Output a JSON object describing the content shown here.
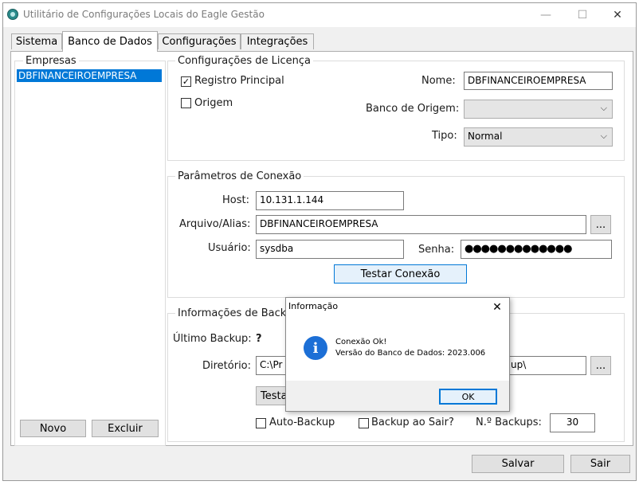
{
  "window": {
    "title": "Utilitário de Configurações Locais do Eagle Gestão",
    "minimize": "—",
    "maximize": "☐",
    "close": "✕"
  },
  "tabs": [
    {
      "label": "Sistema"
    },
    {
      "label": "Banco de Dados"
    },
    {
      "label": "Configurações"
    },
    {
      "label": "Integrações"
    }
  ],
  "empresas": {
    "label": "Empresas",
    "items": [
      "DBFINANCEIROEMPRESA"
    ],
    "novo": "Novo",
    "excluir": "Excluir"
  },
  "licenca": {
    "label": "Configurações de Licença",
    "registro_principal": "Registro Principal",
    "registro_principal_checked": "✓",
    "origem": "Origem",
    "nome_label": "Nome:",
    "nome_value": "DBFINANCEIROEMPRESA",
    "banco_origem_label": "Banco de Origem:",
    "banco_origem_value": "",
    "tipo_label": "Tipo:",
    "tipo_value": "Normal"
  },
  "conexao": {
    "label": "Parâmetros de Conexão",
    "host_label": "Host:",
    "host_value": "10.131.1.144",
    "arquivo_label": "Arquivo/Alias:",
    "arquivo_value": "DBFINANCEIROEMPRESA",
    "browse": "...",
    "usuario_label": "Usuário:",
    "usuario_value": "sysdba",
    "senha_label": "Senha:",
    "senha_value": "●●●●●●●●●●●●●",
    "testar": "Testar Conexão"
  },
  "backup": {
    "label": "Informações de Backup",
    "ultimo_label": "Último Backup:",
    "ultimo_value": "?",
    "diretorio_label": "Diretório:",
    "diretorio_prefix": "C:\\Pr",
    "diretorio_suffix": "up\\",
    "browse": "...",
    "testar_partial": "Testa",
    "auto_backup": "Auto-Backup",
    "backup_sair": "Backup ao Sair?",
    "n_backups_label": "N.º Backups:",
    "n_backups_value": "30"
  },
  "footer": {
    "salvar": "Salvar",
    "sair": "Sair"
  },
  "dialog": {
    "title": "Informação",
    "close": "✕",
    "icon": "i",
    "line1": "Conexão Ok!",
    "line2": "Versão do Banco de Dados: 2023.006",
    "ok": "OK"
  },
  "colors": {
    "selection": "#0078d7",
    "info_icon": "#1c6fd6"
  }
}
